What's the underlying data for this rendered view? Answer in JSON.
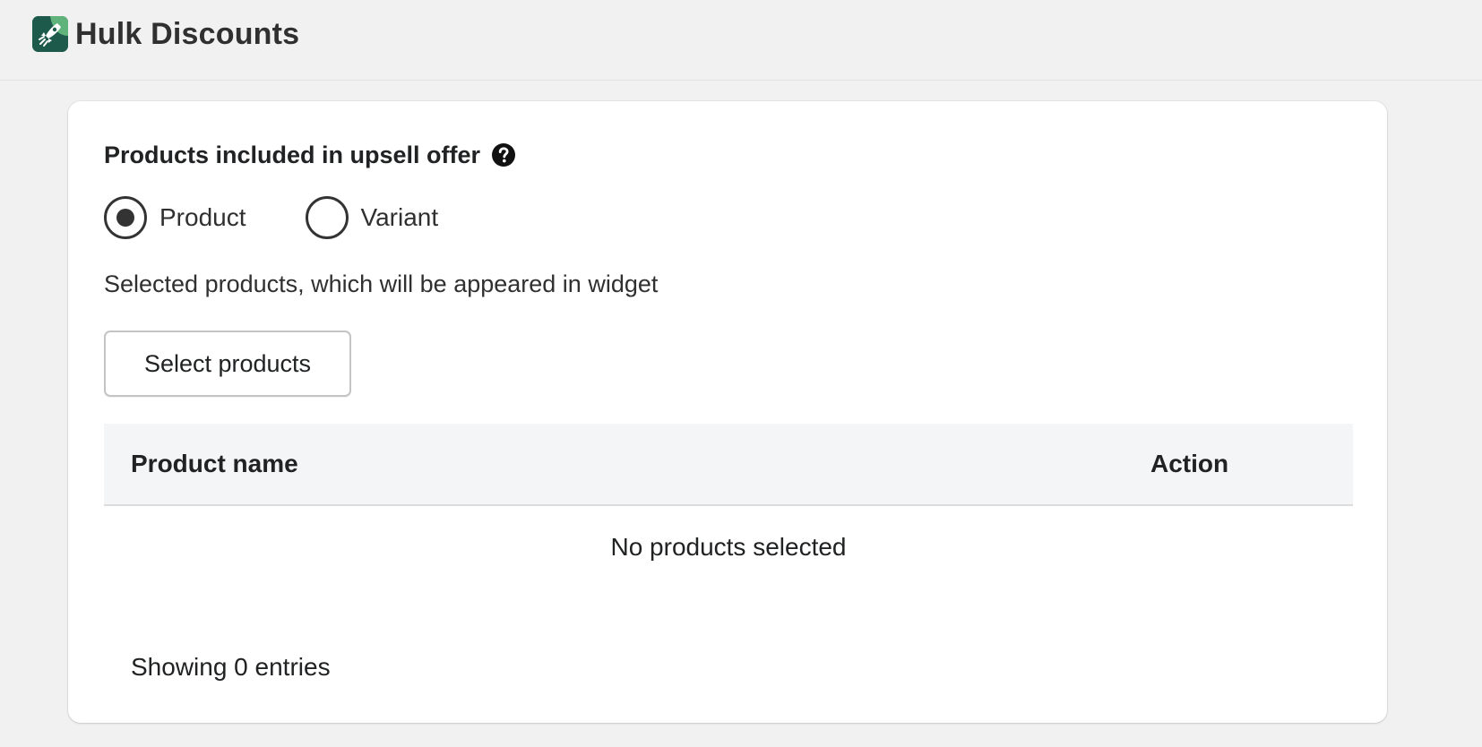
{
  "header": {
    "app_name": "Hulk Discounts",
    "logo_icon": "rocket-leaf-logo",
    "logo_color": "#1d5a4b"
  },
  "card": {
    "section_title": "Products included in upsell offer",
    "help_icon": "question-circle-icon",
    "radio_options": [
      {
        "label": "Product",
        "selected": true
      },
      {
        "label": "Variant",
        "selected": false
      }
    ],
    "helper_text": "Selected products, which will be appeared in widget",
    "select_button_label": "Select products",
    "table": {
      "columns": [
        "Product name",
        "Action"
      ],
      "rows": [],
      "empty_message": "No products selected"
    },
    "entries_text": "Showing 0 entries"
  }
}
